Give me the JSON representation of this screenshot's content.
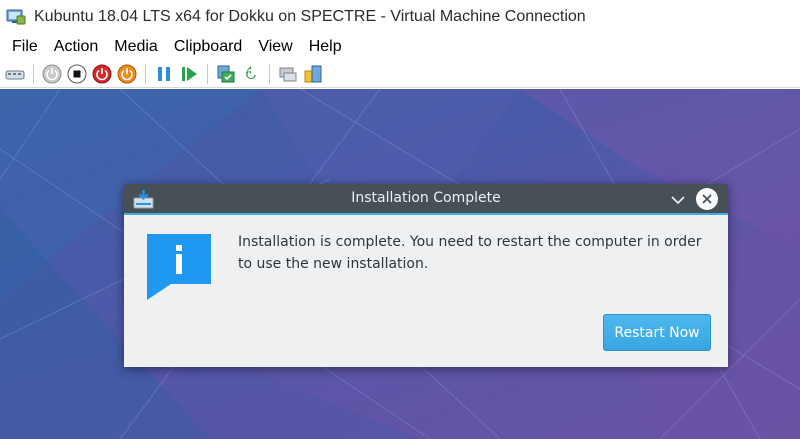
{
  "window": {
    "title": "Kubuntu 18.04 LTS x64 for Dokku on SPECTRE - Virtual Machine Connection",
    "icon": "virtual-machine-icon"
  },
  "menu": [
    "File",
    "Action",
    "Media",
    "Clipboard",
    "View",
    "Help"
  ],
  "toolbar": {
    "buttons": [
      "ctrl-alt-del-icon",
      "start-icon",
      "turn-off-icon",
      "shut-down-icon",
      "power-icon",
      "pause-icon",
      "resume-icon",
      "checkpoint-icon",
      "revert-icon",
      "enhanced-session-icon",
      "share-icon"
    ]
  },
  "dialog": {
    "title": "Installation Complete",
    "message": "Installation is complete. You need to restart the computer in order to use the new installation.",
    "button_label": "Restart Now",
    "icons": [
      "installer-icon",
      "chevron-down-icon",
      "close-icon",
      "info-icon"
    ]
  },
  "colors": {
    "dialog_titlebar": "#475057",
    "accent": "#3daee9",
    "dialog_bg": "#eff0f1",
    "desktop": "#4a5aa8"
  }
}
